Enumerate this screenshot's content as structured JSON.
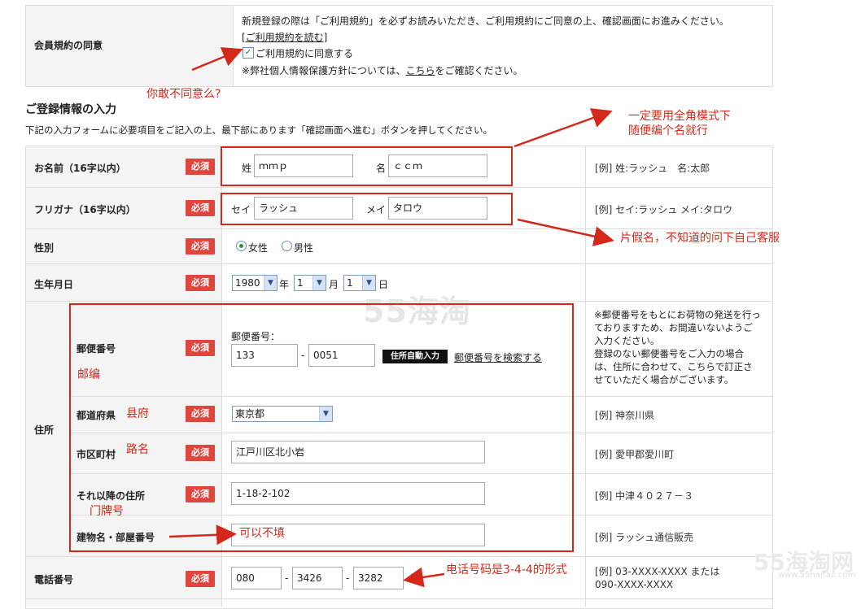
{
  "consent": {
    "label": "会員規約の同意",
    "notice": "新規登録の際は「ご利用規約」を必ずお読みいただき、ご利用規約にご同意の上、確認画面にお進みください。",
    "read_terms_link": "[ご利用規約を読む]",
    "agree_label": "ご利用規約に同意する",
    "privacy_prefix": "※弊社個人情報保護方針については、",
    "privacy_link": "こちら",
    "privacy_suffix": "をご確認ください。"
  },
  "section": {
    "title": "ご登録情報の入力",
    "instruction": "下記の入力フォームに必要項目をご記入の上、最下部にあります「確認画面へ進む」ボタンを押してください。"
  },
  "required_badge": "必須",
  "name": {
    "label": "お名前（16字以内）",
    "sei_label": "姓",
    "sei_value": "ｍｍｐ",
    "mei_label": "名",
    "mei_value": "ｃｃｍ",
    "example": "[例] 姓:ラッシュ　名:太郎"
  },
  "furigana": {
    "label": "フリガナ（16字以内）",
    "sei_label": "セイ",
    "sei_value": "ラッシュ",
    "mei_label": "メイ",
    "mei_value": "タロウ",
    "example": "[例] セイ:ラッシュ メイ:タロウ"
  },
  "gender": {
    "label": "性別",
    "female": "女性",
    "male": "男性"
  },
  "birthday": {
    "label": "生年月日",
    "year": "1980",
    "year_unit": "年",
    "month": "1",
    "month_unit": "月",
    "day": "1",
    "day_unit": "日"
  },
  "address": {
    "label": "住所",
    "postal_label": "郵便番号",
    "postal_caption": "郵便番号：",
    "postal1": "133",
    "postal_dash": "-",
    "postal2": "0051",
    "auto_button": "住所自動入力",
    "search_link": "郵便番号を検索する",
    "postal_note": "※郵便番号をもとにお荷物の発送を行っておりますため、お間違いないようご入力ください。\n登録のない郵便番号をご入力の場合は、住所に合わせて、こちらで訂正させていただく場合がございます。",
    "pref_label": "都道府県",
    "pref_value": "東京都",
    "pref_example": "[例] 神奈川県",
    "city_label": "市区町村",
    "city_value": "江戸川区北小岩",
    "city_example": "[例] 愛甲郡愛川町",
    "street_label": "それ以降の住所",
    "street_value": "1-18-2-102",
    "street_example": "[例] 中津４０２７－３",
    "building_label": "建物名・部屋番号",
    "building_value": "",
    "building_example": "[例] ラッシュ通信販売"
  },
  "phone": {
    "label": "電話番号",
    "part1": "080",
    "part2": "3426",
    "part3": "3282",
    "dash": "-",
    "example": "[例] 03-XXXX-XXXX または\n090-XXXX-XXXX"
  },
  "annotations": {
    "dare": "你敢不同意么?",
    "fullwidth_1": "一定要用全角模式下",
    "fullwidth_2": "随便编个名就行",
    "katakana": "片假名，不知道的问下自己客服",
    "postcode": "邮编",
    "prefecture": "县府",
    "road": "路名",
    "door": "门牌号",
    "optional": "可以不填",
    "phone_format": "电话号码是3-4-4的形式"
  },
  "watermark": {
    "center": "55海淘",
    "corner": "55海淘网",
    "corner_url": "www.55haitao.com"
  },
  "colors": {
    "required": "#e0463e",
    "annotation": "#d4281b",
    "label_bg": "#f4f4f4"
  }
}
